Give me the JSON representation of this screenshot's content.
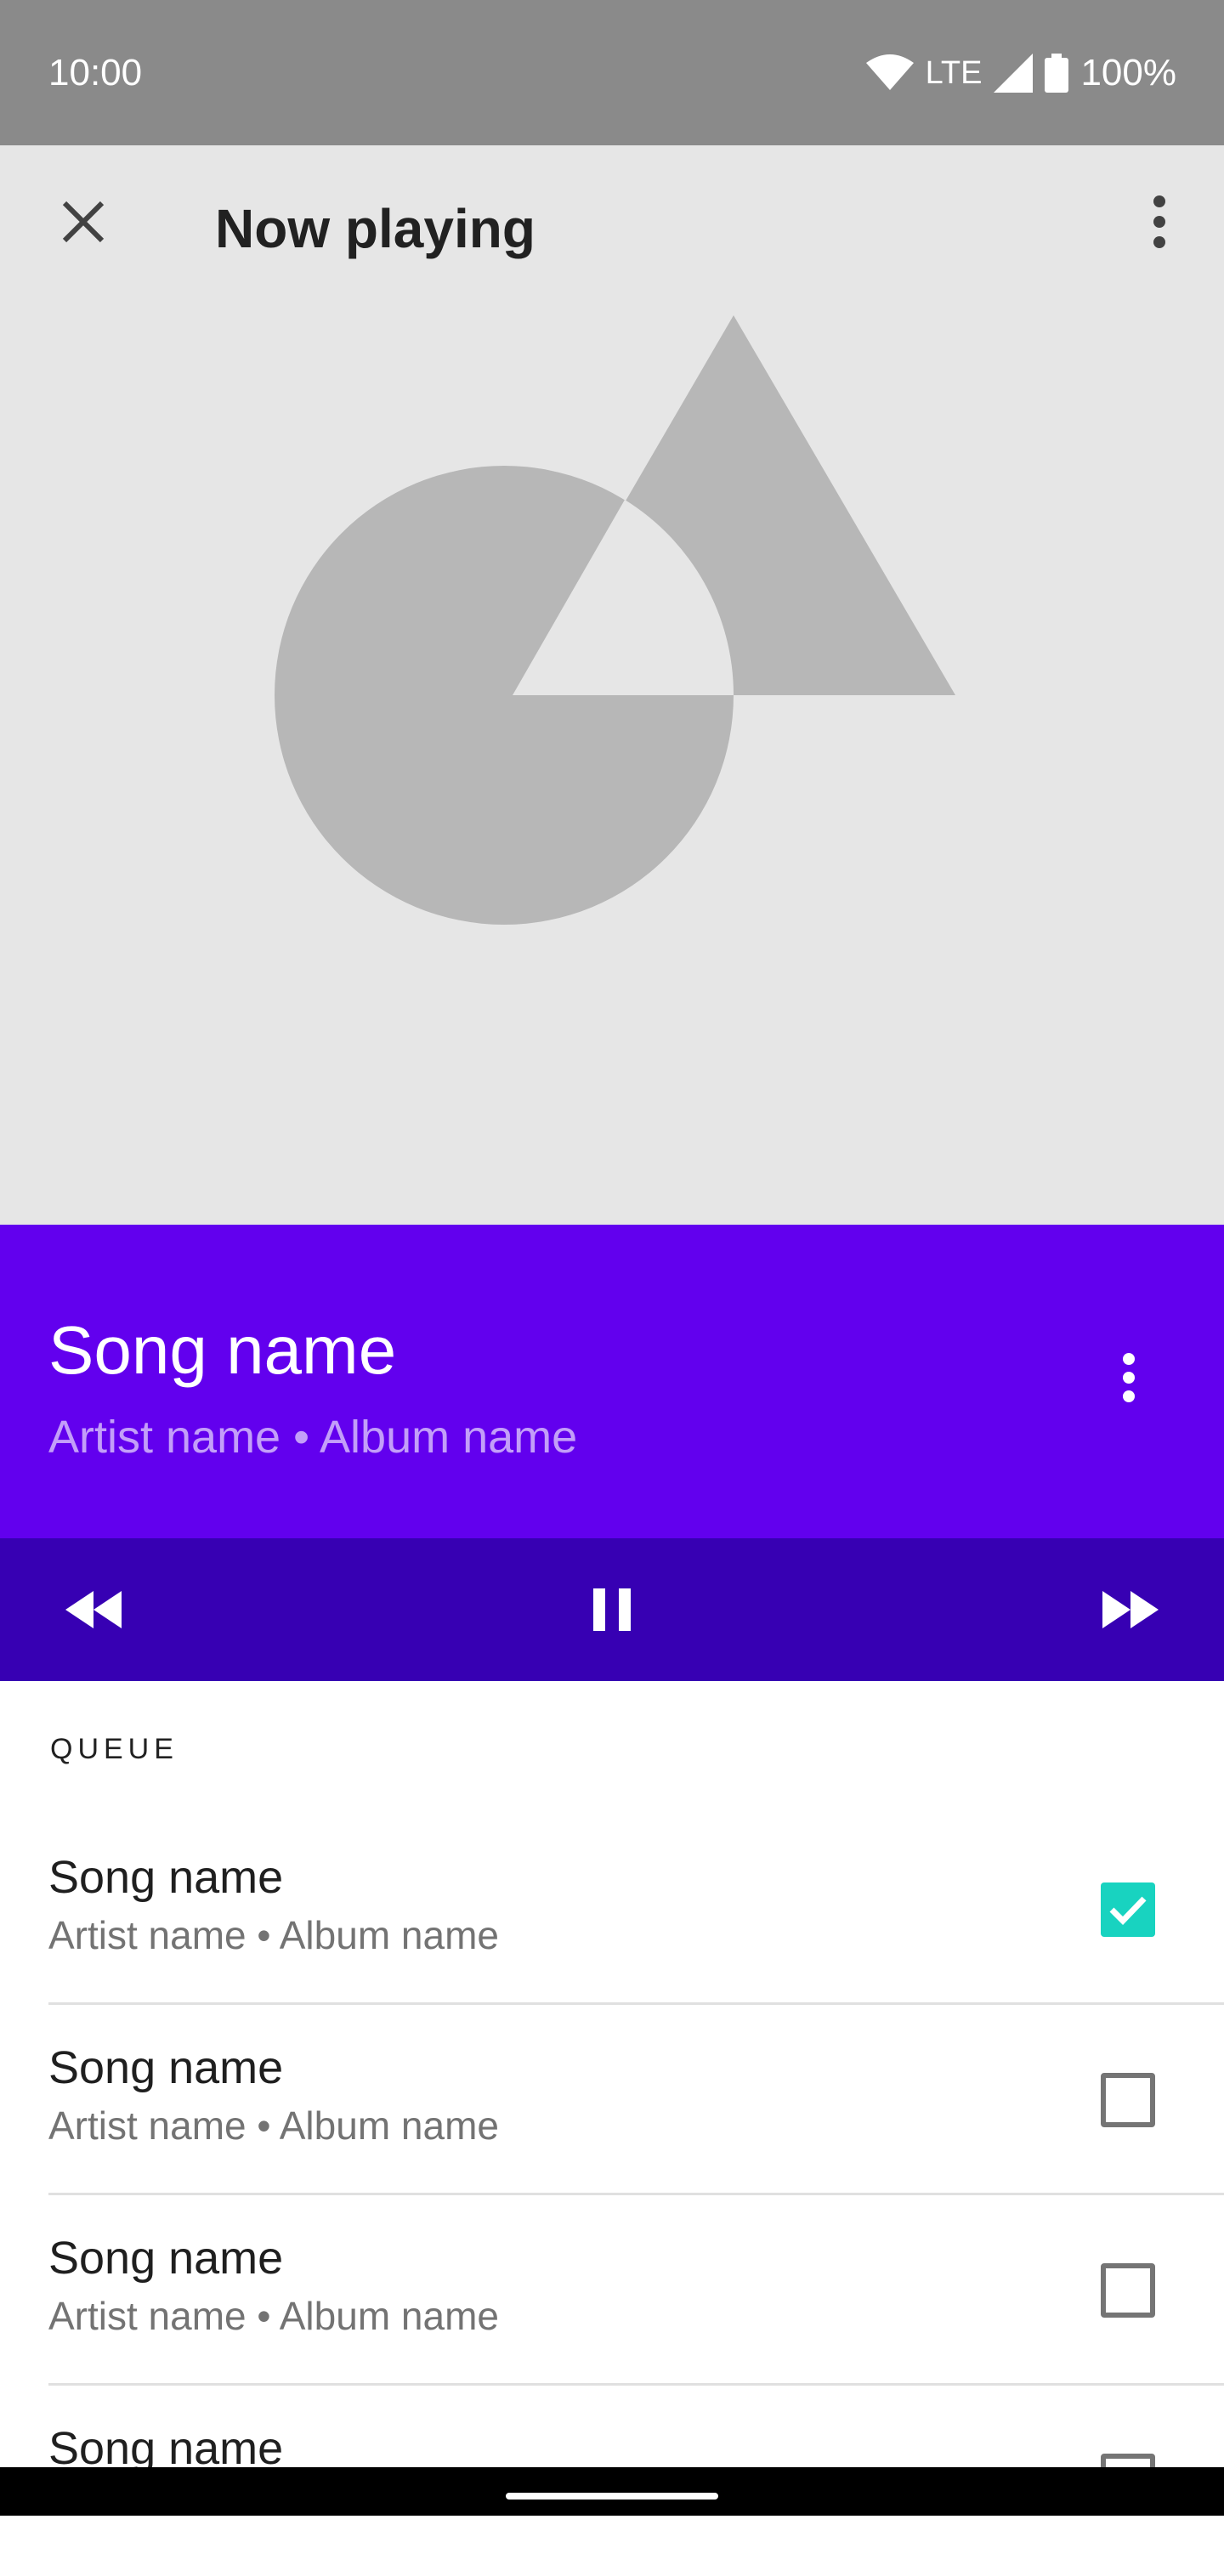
{
  "status_bar": {
    "time": "10:00",
    "network": "LTE",
    "battery": "100%"
  },
  "app_bar": {
    "title": "Now playing",
    "close_icon": "close-icon",
    "more_icon": "more-vert-icon"
  },
  "artwork": {
    "colors": {
      "background": "#e6e6e6",
      "shape": "#b7b7b7"
    }
  },
  "now_playing": {
    "title": "Song name",
    "subtitle": "Artist name • Album name",
    "background": "#6200ee"
  },
  "controls": {
    "background": "#3700b3",
    "rewind_icon": "rewind-icon",
    "pause_icon": "pause-icon",
    "fast_forward_icon": "fast-forward-icon"
  },
  "queue": {
    "header": "QUEUE",
    "items": [
      {
        "title": "Song name",
        "subtitle": "Artist name • Album name",
        "checked": true
      },
      {
        "title": "Song name",
        "subtitle": "Artist name • Album name",
        "checked": false
      },
      {
        "title": "Song name",
        "subtitle": "Artist name • Album name",
        "checked": false
      },
      {
        "title": "Song name",
        "subtitle": "",
        "checked": false
      }
    ],
    "accent": "#18d3c0"
  }
}
